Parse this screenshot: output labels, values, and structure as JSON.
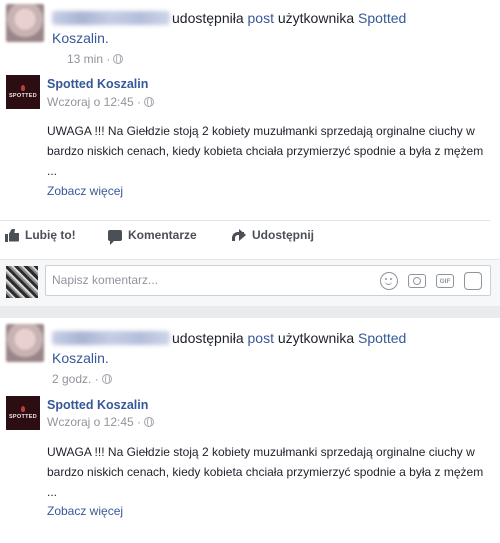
{
  "posts": [
    {
      "share_line": {
        "action": "udostępniła",
        "post_word": "post",
        "middle": "użytkownika",
        "page_link": "Spotted",
        "page_link2": "Koszalin."
      },
      "time": "13 min ·",
      "inner": {
        "logo_text": "SPOTTED",
        "page_name": "Spotted Koszalin",
        "time": "Wczoraj o 12:45 ·",
        "text": "UWAGA !!! Na Giełdzie stoją 2 kobiety muzułmanki sprzedają orginalne ciuchy w bardzo niskich cenach, kiedy kobieta chciała przymierzyć spodnie a była z mężem ...",
        "see_more": "Zobacz więcej"
      },
      "actions": {
        "like": "Lubię to!",
        "comment": "Komentarze",
        "share": "Udostępnij"
      },
      "comment_box": {
        "placeholder": "Napisz komentarz...",
        "icons": [
          "emoji-icon",
          "camera-icon",
          "gif-icon",
          "sticker-icon"
        ],
        "gif_label": "GIF"
      }
    },
    {
      "share_line": {
        "action": "udostępniła",
        "post_word": "post",
        "middle": "użytkownika",
        "page_link": "Spotted",
        "page_link2": "Koszalin."
      },
      "time": "2 godz. ·",
      "inner": {
        "logo_text": "SPOTTED",
        "page_name": "Spotted Koszalin",
        "time": "Wczoraj o 12:45 ·",
        "text": "UWAGA !!! Na Giełdzie stoją 2 kobiety muzułmanki sprzedają orginalne ciuchy w bardzo niskich cenach, kiedy kobieta chciała przymierzyć spodnie a była z mężem ...",
        "see_more": "Zobacz więcej"
      }
    }
  ],
  "colors": {
    "link": "#365899",
    "meta": "#90949c",
    "text": "#1d2129",
    "background": "#e9ebee"
  }
}
